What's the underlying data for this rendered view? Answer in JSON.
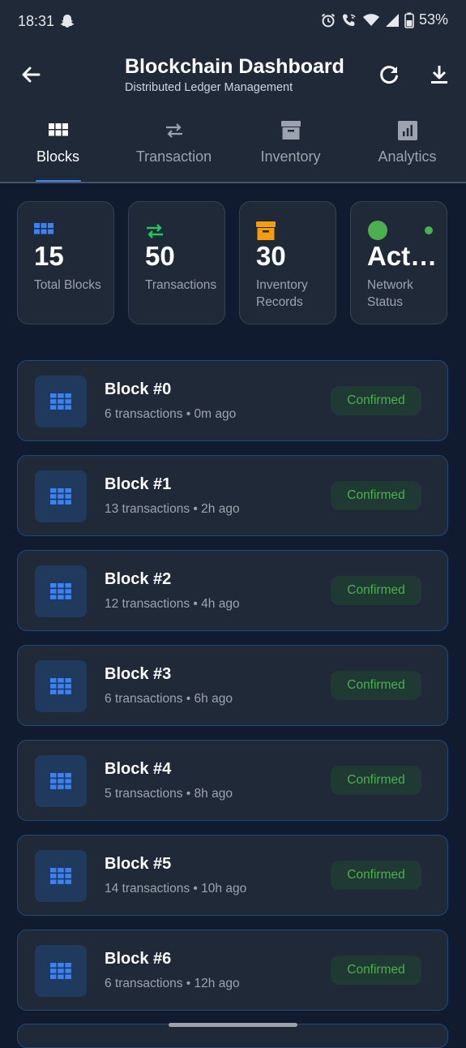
{
  "status_bar": {
    "time": "18:31",
    "battery": "53%"
  },
  "app_bar": {
    "title": "Blockchain Dashboard",
    "subtitle": "Distributed Ledger Management"
  },
  "tabs": [
    {
      "label": "Blocks",
      "icon": "blocks-grid-icon",
      "active": true
    },
    {
      "label": "Transaction",
      "icon": "swap-arrows-icon",
      "active": false
    },
    {
      "label": "Inventory",
      "icon": "archive-box-icon",
      "active": false
    },
    {
      "label": "Analytics",
      "icon": "bar-chart-icon",
      "active": false
    }
  ],
  "stats": [
    {
      "value": "15",
      "label": "Total Blocks",
      "icon": "blocks-grid-icon",
      "color": "#3b82f6"
    },
    {
      "value": "50",
      "label": "Transactions",
      "icon": "swap-arrows-icon",
      "color": "#22c55e"
    },
    {
      "value": "30",
      "label": "Inventory Records",
      "icon": "archive-box-icon",
      "color": "#f59e0b"
    },
    {
      "value": "Act…",
      "label": "Network Status",
      "icon": "status-dot-icon",
      "color": "#4caf50"
    }
  ],
  "blocks": [
    {
      "title": "Block #0",
      "meta": "6 transactions • 0m ago",
      "status": "Confirmed"
    },
    {
      "title": "Block #1",
      "meta": "13 transactions • 2h ago",
      "status": "Confirmed"
    },
    {
      "title": "Block #2",
      "meta": "12 transactions • 4h ago",
      "status": "Confirmed"
    },
    {
      "title": "Block #3",
      "meta": "6 transactions • 6h ago",
      "status": "Confirmed"
    },
    {
      "title": "Block #4",
      "meta": "5 transactions • 8h ago",
      "status": "Confirmed"
    },
    {
      "title": "Block #5",
      "meta": "14 transactions • 10h ago",
      "status": "Confirmed"
    },
    {
      "title": "Block #6",
      "meta": "6 transactions • 12h ago",
      "status": "Confirmed"
    }
  ],
  "colors": {
    "background": "#101b30",
    "surface": "#1f2937",
    "accent": "#3b82f6",
    "confirmed": "#4caf50"
  }
}
